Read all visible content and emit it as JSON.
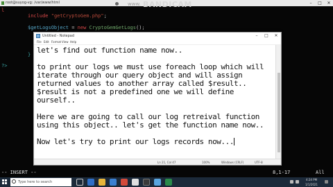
{
  "terminal": {
    "title": "root@suyog-vg: /var/www/html",
    "window_controls": [
      "–",
      "□",
      "✕"
    ],
    "lines": [
      {
        "prefix": "",
        "parts": [
          {
            "cls": "c-red",
            "text": "include"
          },
          {
            "cls": "c-op",
            "text": " "
          },
          {
            "cls": "c-str",
            "text": "\"getCryptoGem.php\""
          },
          {
            "cls": "c-op",
            "text": ";"
          }
        ]
      },
      {
        "prefix": "",
        "parts": [
          {
            "cls": "c-var",
            "text": "$getLogsObject"
          },
          {
            "cls": "c-op",
            "text": " = "
          },
          {
            "cls": "c-red",
            "text": "new"
          },
          {
            "cls": "c-op",
            "text": " "
          },
          {
            "cls": "c-fn",
            "text": "CryptoGemGetLogs"
          },
          {
            "cls": "c-op",
            "text": "();"
          }
        ]
      }
    ],
    "left_marks": [
      "l",
      "?>",
      "}"
    ],
    "recorder_brand": "BANDICAM",
    "recorder_site": "www."
  },
  "notepad": {
    "title": "Untitled - Notepad",
    "menu": [
      "File",
      "Edit",
      "Format",
      "View",
      "Help"
    ],
    "text_lines": [
      "let's find out function name now..",
      "",
      "to print our logs we must use foreach loop which will",
      "iterate through our query object and will assign",
      "returned values to another array called $result..",
      "$result is not a predefined one we will define",
      "ourself..",
      "",
      "Here we are going to call our log retreival function",
      "using this object.. let's get the function name now..",
      "",
      "Now let's try to print our logs records now..."
    ],
    "status": {
      "position": "Ln 21, Col 47",
      "zoom": "100%",
      "line_ending": "Windows (CRLF)",
      "encoding": "UTF-8"
    }
  },
  "vim": {
    "mode": "-- INSERT --",
    "position": "8,1-17",
    "scroll": "All"
  },
  "taskbar": {
    "search_placeholder": "Type here to search",
    "time": "4:24 PM",
    "date": "1/1/2021"
  }
}
